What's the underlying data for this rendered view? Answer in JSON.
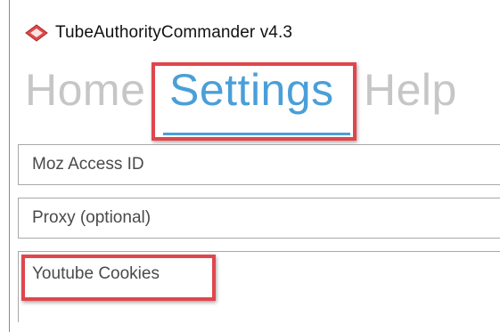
{
  "window": {
    "title": "TubeAuthorityCommander v4.3",
    "icon": "red-diamond-app-icon"
  },
  "tabs": [
    {
      "label": "Home",
      "active": false
    },
    {
      "label": "Settings",
      "active": true
    },
    {
      "label": "Help",
      "active": false
    }
  ],
  "fields": {
    "moz_access_id": {
      "placeholder": "Moz Access ID",
      "value": ""
    },
    "proxy": {
      "placeholder": "Proxy (optional)",
      "value": ""
    },
    "youtube_cookies": {
      "placeholder": "Youtube Cookies",
      "value": ""
    }
  },
  "colors": {
    "active_tab": "#4a9fd8",
    "inactive_tab": "#c6c6c6",
    "highlight": "#e0464c"
  }
}
